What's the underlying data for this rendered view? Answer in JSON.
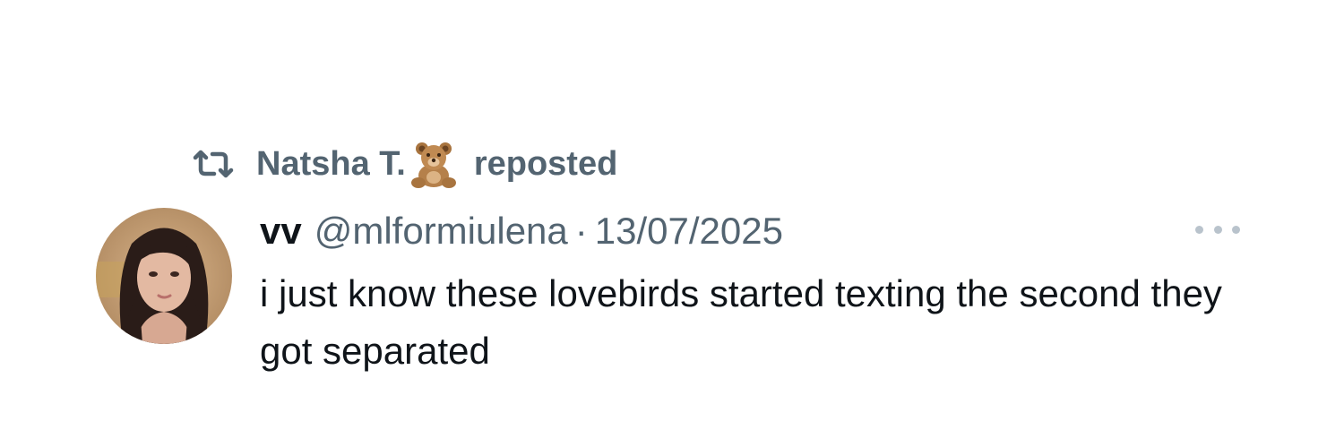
{
  "repost": {
    "user_name": "Natsha T.",
    "emoji": "🧸",
    "action_text": "reposted",
    "icon": "repost-icon"
  },
  "tweet": {
    "display_name": "vv",
    "handle": "@mlformiulena",
    "separator": "·",
    "date": "13/07/2025",
    "text": "i just know these lovebirds started texting the second they got separated",
    "avatar_icon": "avatar-photo",
    "more_icon": "more-options-icon"
  },
  "colors": {
    "primary_text": "#0f1419",
    "secondary_text": "#536471",
    "more_dots": "#b9c3cc",
    "background": "#ffffff"
  }
}
